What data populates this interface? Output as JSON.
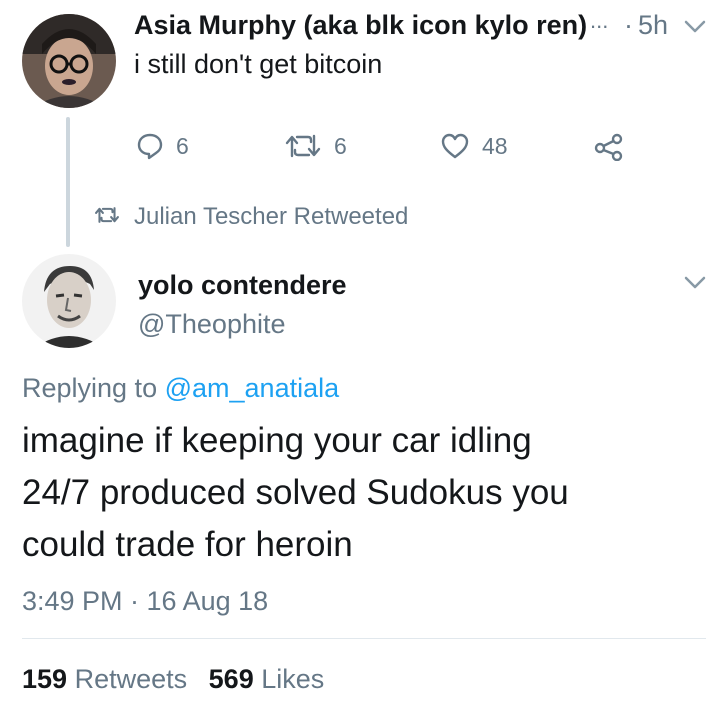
{
  "parent_tweet": {
    "author_name": "Asia Murphy (aka blk icon kylo ren)",
    "ellipsis": "...",
    "time_sep": "·",
    "time": "5h",
    "text": "i still don't get bitcoin",
    "replies": "6",
    "retweets": "6",
    "likes": "48"
  },
  "retweet_notice": {
    "text": "Julian Tescher Retweeted"
  },
  "main_tweet": {
    "author_name": "yolo contendere",
    "handle": "@Theophite",
    "replying_prefix": "Replying to",
    "replying_handle": "@am_anatiala",
    "text_lines": [
      "imagine if keeping your car idling",
      "24/7 produced solved Sudokus you",
      "could trade for heroin"
    ],
    "timestamp": "3:49 PM · 16 Aug 18",
    "retweet_count": "159",
    "retweet_label": "Retweets",
    "like_count": "569",
    "like_label": "Likes"
  },
  "icons": {
    "reply": "reply-icon",
    "retweet": "retweet-icon",
    "like": "heart-icon",
    "share": "share-icon",
    "caret": "chevron-down-icon"
  },
  "colors": {
    "text": "#14171a",
    "muted": "#657786",
    "link": "#1da1f2",
    "thread_line": "#ccd6dd"
  }
}
